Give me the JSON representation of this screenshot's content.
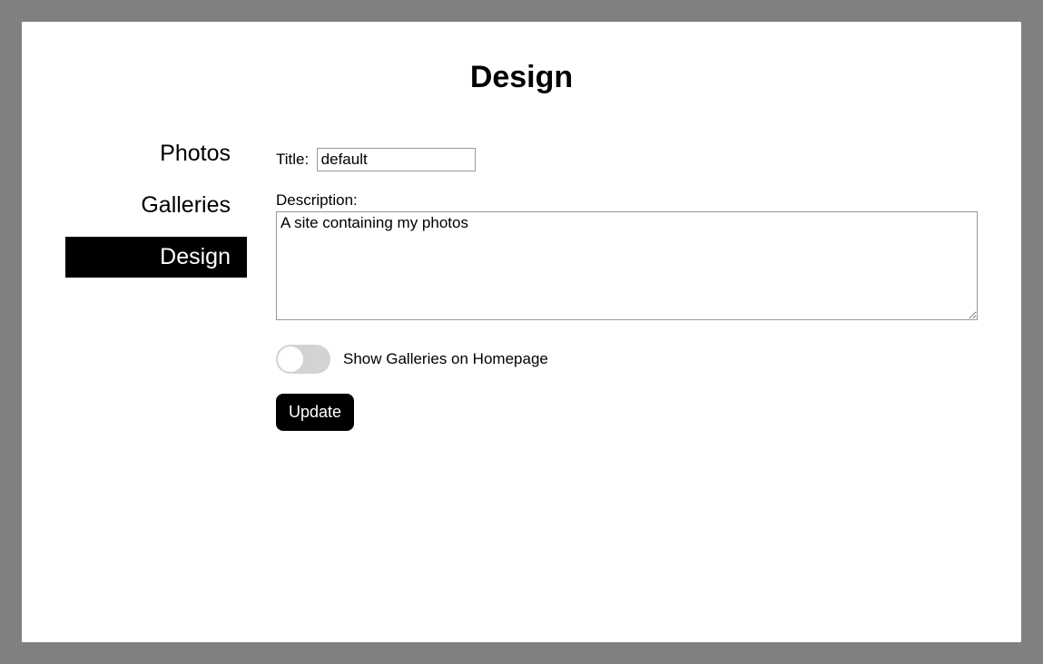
{
  "header": {
    "title": "Design"
  },
  "sidebar": {
    "items": [
      {
        "label": "Photos",
        "active": false
      },
      {
        "label": "Galleries",
        "active": false
      },
      {
        "label": "Design",
        "active": true
      }
    ]
  },
  "form": {
    "title_label": "Title:",
    "title_value": "default",
    "description_label": "Description:",
    "description_value": "A site containing my photos",
    "toggle_label": "Show Galleries on Homepage",
    "toggle_on": false,
    "submit_label": "Update"
  }
}
